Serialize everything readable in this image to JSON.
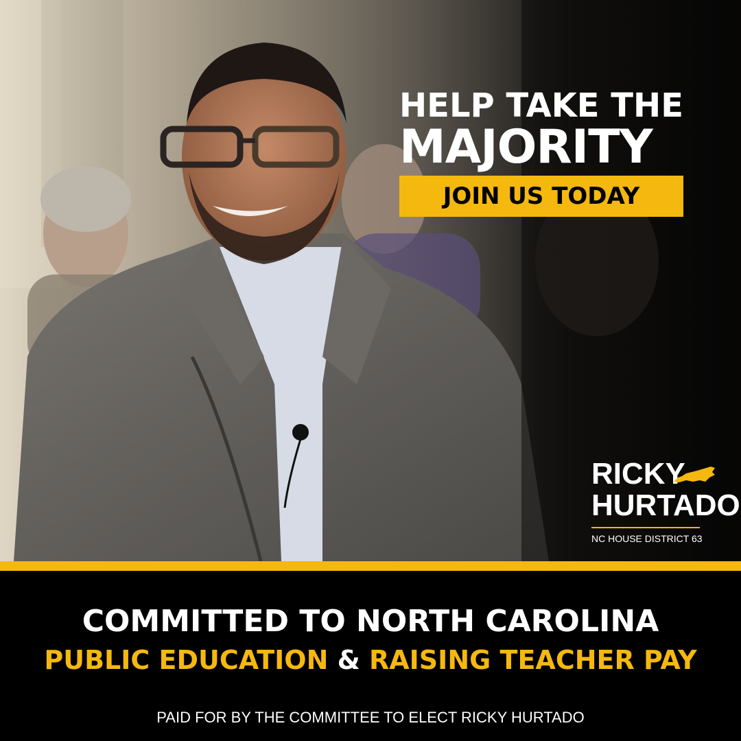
{
  "colors": {
    "accent_gold": "#F5B80F",
    "text_white": "#FFFFFF",
    "panel_black": "#000000"
  },
  "headline": {
    "line1": "HELP TAKE THE",
    "line2": "MAJORITY"
  },
  "cta": {
    "label": "JOIN US TODAY"
  },
  "logo": {
    "first_name": "RICKY",
    "last_name": "HURTADO",
    "district": "NC HOUSE DISTRICT 63",
    "icon": "north-carolina-state-icon"
  },
  "message": {
    "line1": "COMMITTED TO NORTH CAROLINA",
    "line2_part1": "PUBLIC EDUCATION",
    "line2_amp": "&",
    "line2_part2": "RAISING TEACHER PAY"
  },
  "disclaimer": "PAID FOR BY THE COMMITTEE TO ELECT RICKY HURTADO"
}
